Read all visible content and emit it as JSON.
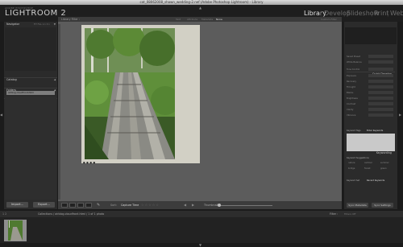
{
  "window": {
    "title": "cat_08062008_shawn_wedding-2.nef (Adobe Photoshop Lightroom) - Library"
  },
  "identity_plate": {
    "small_text": "ADOBE PHOTOSHOP",
    "logo": "LIGHTROOM 2"
  },
  "modules": [
    "Library",
    "Develop",
    "Slideshow",
    "Print",
    "Web"
  ],
  "left_panel": {
    "navigator": "Navigator",
    "navigator_options": "FIT   FILL   1:1   3:1",
    "catalog": "Catalog",
    "folders": "Folders",
    "collections": "Collections",
    "collection_item": "airblog.cloudfront.html",
    "import_label": "Import...",
    "export_label": "Export..."
  },
  "filter_bar": {
    "title": "Library Filter :",
    "options": [
      "Text",
      "Attribute",
      "Metadata",
      "None"
    ],
    "right": "Custom Filter"
  },
  "toolbar": {
    "sort_label": "Sort:",
    "sort_value": "Capture Time",
    "stars": "☆☆☆☆☆",
    "thumbnails_label": "Thumbnails"
  },
  "right_panel": {
    "histogram": "Histogram",
    "quick_develop": "Quick Develop",
    "qd_rows": [
      "Saved Preset",
      "White Balance",
      "Tone Control",
      "Exposure",
      "Recovery",
      "Fill Light",
      "Blacks",
      "Brightness",
      "Contrast",
      "Clarity",
      "Vibrance"
    ],
    "keywording": "Keywording",
    "keyword_tags_label": "Keyword Tags",
    "keyword_tags_value": "Enter Keywords",
    "keyword_suggestions_label": "Keyword Suggestions",
    "keyword_suggestions": [
      "nature",
      "outdoor",
      "summer",
      "bridge",
      "forest",
      "green"
    ],
    "keyword_set_label": "Keyword Set",
    "keyword_set_value": "Recent Keywords",
    "sync_meta": "Sync Metadata",
    "sync_settings": "Sync Settings"
  },
  "filmstrip": {
    "nums": "1   2",
    "path": "Collections / airblog.cloudfront.html / 1 of 1 photo",
    "filter_label": "Filter :",
    "filter_value": "Filters Off"
  },
  "colors": {
    "active_module": "#e6e6e6",
    "panel_bg": "#2b2b2b",
    "center_bg": "#5c5c5c"
  }
}
